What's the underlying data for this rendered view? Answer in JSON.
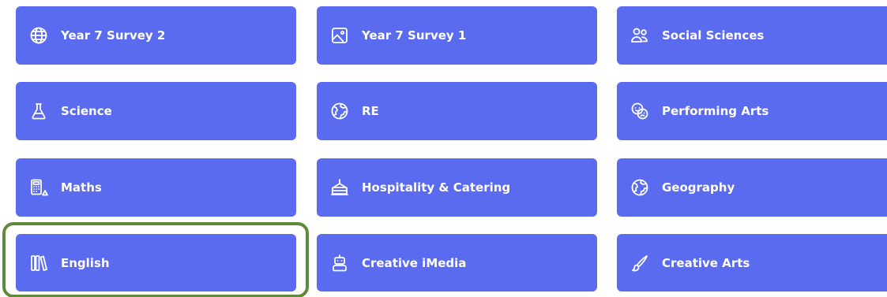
{
  "tiles": [
    {
      "label": "Year 7 Survey 2",
      "icon": "globe-icon"
    },
    {
      "label": "Year 7 Survey 1",
      "icon": "image-icon"
    },
    {
      "label": "Social Sciences",
      "icon": "people-icon"
    },
    {
      "label": "Science",
      "icon": "flask-icon"
    },
    {
      "label": "RE",
      "icon": "world-map-icon"
    },
    {
      "label": "Performing Arts",
      "icon": "theatre-masks-icon"
    },
    {
      "label": "Maths",
      "icon": "calculator-shapes-icon"
    },
    {
      "label": "Hospitality & Catering",
      "icon": "cake-icon"
    },
    {
      "label": "Geography",
      "icon": "world-map-icon"
    },
    {
      "label": "English",
      "icon": "books-icon"
    },
    {
      "label": "Creative iMedia",
      "icon": "robot-icon"
    },
    {
      "label": "Creative Arts",
      "icon": "brush-icon"
    }
  ],
  "colors": {
    "tile_background": "#5b6bef",
    "tile_text": "#ffffff",
    "highlight_border": "#5e8a3a",
    "page_background": "#ffffff"
  },
  "highlighted_tile": "English"
}
